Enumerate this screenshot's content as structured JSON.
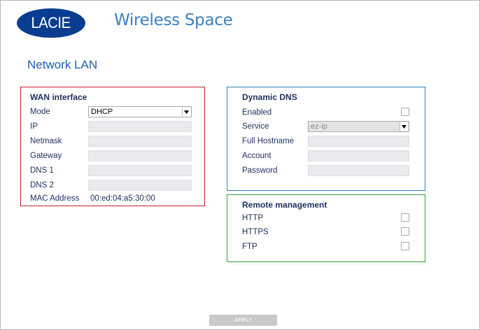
{
  "header": {
    "logo_text": "LACIE",
    "product_title": "Wireless Space"
  },
  "page": {
    "title": "Network LAN"
  },
  "wan": {
    "title": "WAN interface",
    "mode_label": "Mode",
    "mode_value": "DHCP",
    "ip_label": "IP",
    "netmask_label": "Netmask",
    "gateway_label": "Gateway",
    "dns1_label": "DNS 1",
    "dns2_label": "DNS 2",
    "mac_label": "MAC Address",
    "mac_value": "00:ed:04:a5:30:00"
  },
  "ddns": {
    "title": "Dynamic DNS",
    "enabled_label": "Enabled",
    "enabled_checked": false,
    "service_label": "Service",
    "service_value": "ez-ip",
    "hostname_label": "Full Hostname",
    "account_label": "Account",
    "password_label": "Password"
  },
  "remote": {
    "title": "Remote management",
    "http_label": "HTTP",
    "https_label": "HTTPS",
    "ftp_label": "FTP",
    "http_checked": false,
    "https_checked": false,
    "ftp_checked": false
  },
  "actions": {
    "apply_label": "APPLY"
  },
  "colors": {
    "brand": "#0a3d91",
    "title_blue": "#1c5fae",
    "wan_border": "#c41f2b",
    "ddns_border": "#2d7fc4",
    "remote_border": "#3f9a3c"
  },
  "icons": {
    "select_arrow": "chevron-down-icon",
    "checkbox": "checkbox-unchecked-icon"
  }
}
